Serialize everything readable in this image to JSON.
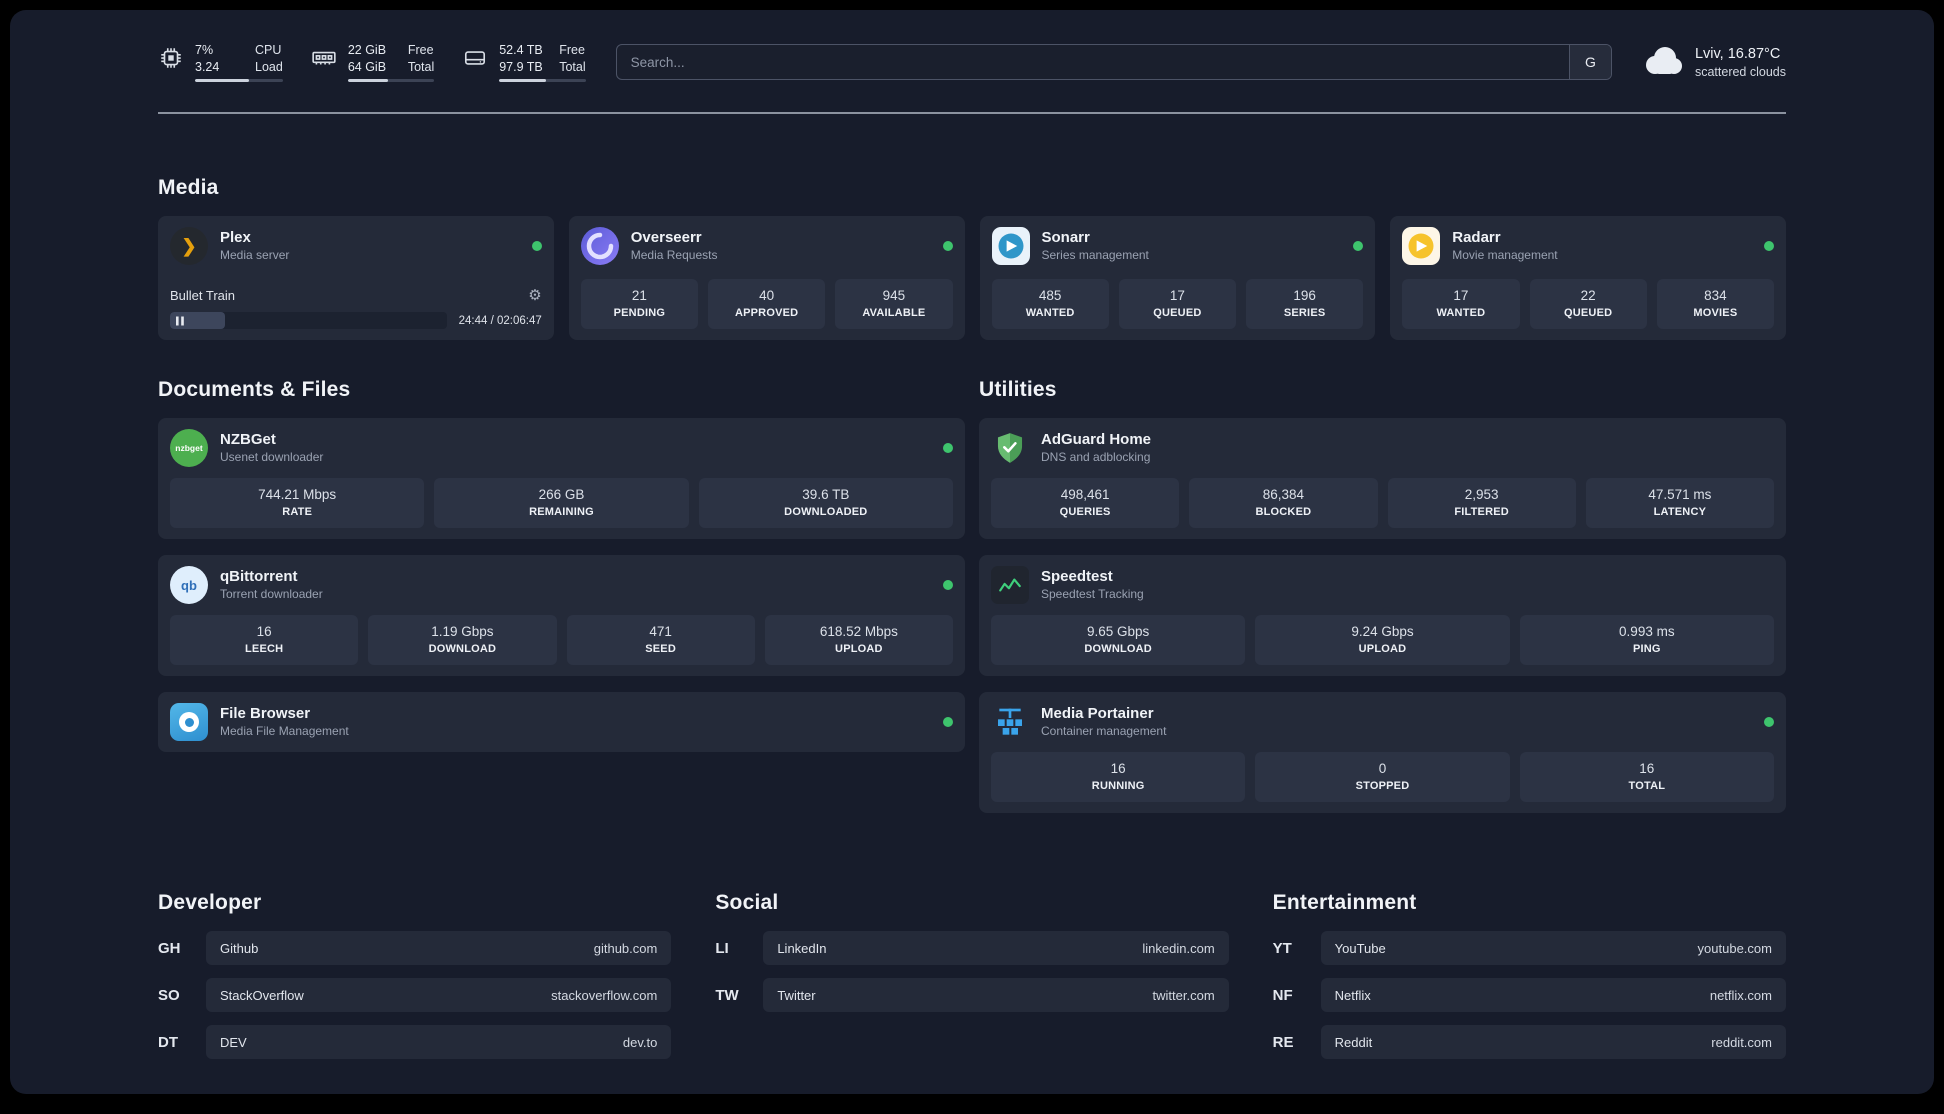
{
  "colors": {
    "page_bg": "#171c2b",
    "card_bg": "#242a39",
    "tile_bg": "#2c3344",
    "status_online": "#3ec46d",
    "plex_gold": "#e5a00d",
    "adguard_green": "#63b768",
    "portainer_blue": "#3aa4eb",
    "speedtest_green": "#3fd07c"
  },
  "header": {
    "cpu": {
      "value_top": "7%",
      "value_bottom": "3.24",
      "label_top": "CPU",
      "label_bottom": "Load",
      "bar_style": "width:62%"
    },
    "ram": {
      "value_top": "22 GiB",
      "value_bottom": "64 GiB",
      "label_top": "Free",
      "label_bottom": "Total",
      "bar_style": "width:46%"
    },
    "disk": {
      "value_top": "52.4 TB",
      "value_bottom": "97.9 TB",
      "label_top": "Free",
      "label_bottom": "Total",
      "bar_style": "width:54%"
    },
    "search": {
      "placeholder": "Search...",
      "engine_label": "G"
    },
    "weather": {
      "location": "Lviv, 16.87°C",
      "condition": "scattered clouds"
    }
  },
  "sections": {
    "media": {
      "title": "Media",
      "plex": {
        "name": "Plex",
        "subtitle": "Media server",
        "now_playing": "Bullet Train",
        "time": "24:44 / 02:06:47",
        "progress_style": "width:20%"
      },
      "overseerr": {
        "name": "Overseerr",
        "subtitle": "Media Requests",
        "stats": [
          {
            "value": "21",
            "label": "PENDING"
          },
          {
            "value": "40",
            "label": "APPROVED"
          },
          {
            "value": "945",
            "label": "AVAILABLE"
          }
        ]
      },
      "sonarr": {
        "name": "Sonarr",
        "subtitle": "Series management",
        "stats": [
          {
            "value": "485",
            "label": "WANTED"
          },
          {
            "value": "17",
            "label": "QUEUED"
          },
          {
            "value": "196",
            "label": "SERIES"
          }
        ]
      },
      "radarr": {
        "name": "Radarr",
        "subtitle": "Movie management",
        "stats": [
          {
            "value": "17",
            "label": "WANTED"
          },
          {
            "value": "22",
            "label": "QUEUED"
          },
          {
            "value": "834",
            "label": "MOVIES"
          }
        ]
      }
    },
    "documents": {
      "title": "Documents & Files",
      "nzbget": {
        "name": "NZBGet",
        "subtitle": "Usenet downloader",
        "icon_text": "nzbget",
        "stats": [
          {
            "value": "744.21 Mbps",
            "label": "RATE"
          },
          {
            "value": "266 GB",
            "label": "REMAINING"
          },
          {
            "value": "39.6 TB",
            "label": "DOWNLOADED"
          }
        ]
      },
      "qbittorrent": {
        "name": "qBittorrent",
        "subtitle": "Torrent downloader",
        "icon_text": "qb",
        "stats": [
          {
            "value": "16",
            "label": "LEECH"
          },
          {
            "value": "1.19 Gbps",
            "label": "DOWNLOAD"
          },
          {
            "value": "471",
            "label": "SEED"
          },
          {
            "value": "618.52 Mbps",
            "label": "UPLOAD"
          }
        ]
      },
      "filebrowser": {
        "name": "File Browser",
        "subtitle": "Media File Management"
      }
    },
    "utilities": {
      "title": "Utilities",
      "adguard": {
        "name": "AdGuard Home",
        "subtitle": "DNS and adblocking",
        "stats": [
          {
            "value": "498,461",
            "label": "QUERIES"
          },
          {
            "value": "86,384",
            "label": "BLOCKED"
          },
          {
            "value": "2,953",
            "label": "FILTERED"
          },
          {
            "value": "47.571 ms",
            "label": "LATENCY"
          }
        ]
      },
      "speedtest": {
        "name": "Speedtest",
        "subtitle": "Speedtest Tracking",
        "stats": [
          {
            "value": "9.65 Gbps",
            "label": "DOWNLOAD"
          },
          {
            "value": "9.24 Gbps",
            "label": "UPLOAD"
          },
          {
            "value": "0.993 ms",
            "label": "PING"
          }
        ]
      },
      "portainer": {
        "name": "Media Portainer",
        "subtitle": "Container management",
        "stats": [
          {
            "value": "16",
            "label": "RUNNING"
          },
          {
            "value": "0",
            "label": "STOPPED"
          },
          {
            "value": "16",
            "label": "TOTAL"
          }
        ]
      }
    },
    "bookmarks": {
      "developer": {
        "title": "Developer",
        "items": [
          {
            "abbr": "GH",
            "name": "Github",
            "url": "github.com"
          },
          {
            "abbr": "SO",
            "name": "StackOverflow",
            "url": "stackoverflow.com"
          },
          {
            "abbr": "DT",
            "name": "DEV",
            "url": "dev.to"
          }
        ]
      },
      "social": {
        "title": "Social",
        "items": [
          {
            "abbr": "LI",
            "name": "LinkedIn",
            "url": "linkedin.com"
          },
          {
            "abbr": "TW",
            "name": "Twitter",
            "url": "twitter.com"
          }
        ]
      },
      "entertainment": {
        "title": "Entertainment",
        "items": [
          {
            "abbr": "YT",
            "name": "YouTube",
            "url": "youtube.com"
          },
          {
            "abbr": "NF",
            "name": "Netflix",
            "url": "netflix.com"
          },
          {
            "abbr": "RE",
            "name": "Reddit",
            "url": "reddit.com"
          }
        ]
      }
    }
  }
}
